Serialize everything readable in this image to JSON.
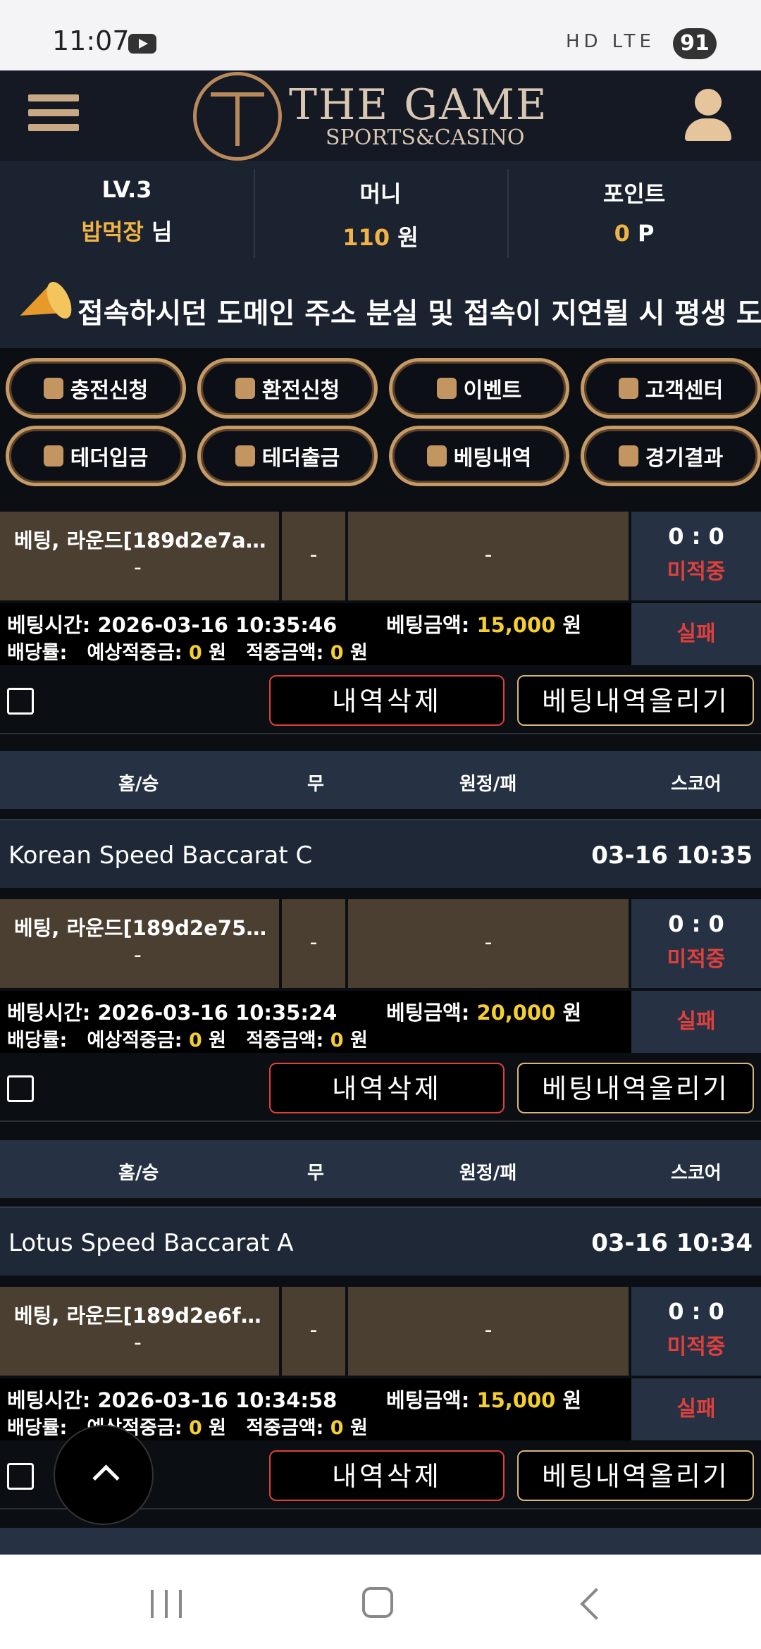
{
  "status": {
    "time": "11:07",
    "battery": "91",
    "icons_text": "HD LTE"
  },
  "header": {
    "logo_title": "THE GAME",
    "logo_sub": "SPORTS&CASINO"
  },
  "info": {
    "level": "LV.3",
    "nickname": "밥먹장",
    "nickname_suffix": "님",
    "money_label": "머니",
    "money_value": "110",
    "money_unit": "원",
    "point_label": "포인트",
    "point_value": "0",
    "point_unit": "P"
  },
  "notice": {
    "text": "접속하시던 도메인 주소 분실 및 접속이 지연될 시 평생 도!"
  },
  "menu": [
    {
      "label": "충전신청",
      "icon": "money-bag-icon"
    },
    {
      "label": "환전신청",
      "icon": "hand-coin-icon"
    },
    {
      "label": "이벤트",
      "icon": "calendar-star-icon"
    },
    {
      "label": "고객센터",
      "icon": "headset-icon"
    },
    {
      "label": "테더입금",
      "icon": "money-bag-icon"
    },
    {
      "label": "테더출금",
      "icon": "hand-coin-icon"
    },
    {
      "label": "베팅내역",
      "icon": "list-icon"
    },
    {
      "label": "경기결과",
      "icon": "scoreboard-icon"
    }
  ],
  "table_headers": {
    "home": "홈/승",
    "draw": "무",
    "away": "원정/패",
    "score": "스코어"
  },
  "labels": {
    "bet_time": "베팅시간:",
    "bet_amount": "베팅금액:",
    "odds": "배당률:",
    "expected": "예상적중금:",
    "hit": "적중금액:",
    "won": "원",
    "delete": "내역삭제",
    "post": "베팅내역올리기"
  },
  "bets": [
    {
      "game": "",
      "game_time": "",
      "bet_label": "베팅, 라운드[189d2e7a91…",
      "bet_sub": "-",
      "draw": "-",
      "away": "-",
      "score": "0 : 0",
      "state": "미적중",
      "bet_time": "2026-03-16 10:35:46",
      "amount": "15,000",
      "expected": "0",
      "hit": "0",
      "result": "실패"
    },
    {
      "game": "Korean Speed Baccarat C",
      "game_time": "03-16 10:35",
      "bet_label": "베팅, 라운드[189d2e758…",
      "bet_sub": "-",
      "draw": "-",
      "away": "-",
      "score": "0 : 0",
      "state": "미적중",
      "bet_time": "2026-03-16 10:35:24",
      "amount": "20,000",
      "expected": "0",
      "hit": "0",
      "result": "실패"
    },
    {
      "game": "Lotus Speed Baccarat A",
      "game_time": "03-16 10:34",
      "bet_label": "베팅, 라운드[189d2e6f8…",
      "bet_sub": "-",
      "draw": "-",
      "away": "-",
      "score": "0 : 0",
      "state": "미적중",
      "bet_time": "2026-03-16 10:34:58",
      "amount": "15,000",
      "expected": "0",
      "hit": "0",
      "result": "실패"
    }
  ],
  "colors": {
    "gold": "#f0b446",
    "amount_yellow": "#f4cf2f",
    "fail_red": "#e0403c",
    "frame_gold": "#c59a67"
  }
}
